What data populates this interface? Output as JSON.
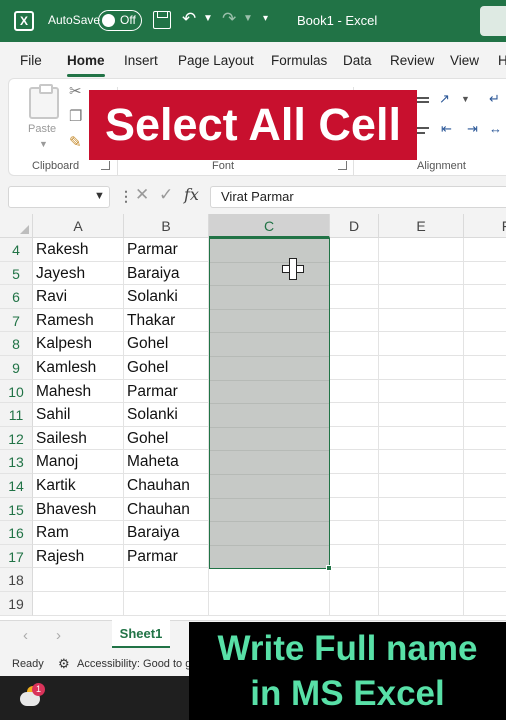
{
  "titlebar": {
    "autosave_label": "AutoSave",
    "autosave_state": "Off",
    "book_title": "Book1  -  Excel"
  },
  "menu": {
    "tabs": [
      "File",
      "Home",
      "Insert",
      "Page Layout",
      "Formulas",
      "Data",
      "Review",
      "View",
      "H"
    ],
    "active": "Home"
  },
  "ribbon": {
    "paste_label": "Paste",
    "groups": [
      "Clipboard",
      "Font",
      "Alignment"
    ]
  },
  "formula_bar": {
    "fx_label": "fx",
    "value": "Virat Parmar"
  },
  "grid": {
    "columns": [
      "A",
      "B",
      "C",
      "D",
      "E",
      "F"
    ],
    "selected_column": "C",
    "rows": [
      {
        "num": "4",
        "a": "Rakesh",
        "b": "Parmar"
      },
      {
        "num": "5",
        "a": "Jayesh",
        "b": "Baraiya"
      },
      {
        "num": "6",
        "a": "Ravi",
        "b": "Solanki"
      },
      {
        "num": "7",
        "a": "Ramesh",
        "b": "Thakar"
      },
      {
        "num": "8",
        "a": "Kalpesh",
        "b": "Gohel"
      },
      {
        "num": "9",
        "a": "Kamlesh",
        "b": "Gohel"
      },
      {
        "num": "10",
        "a": "Mahesh",
        "b": "Parmar"
      },
      {
        "num": "11",
        "a": "Sahil",
        "b": "Solanki"
      },
      {
        "num": "12",
        "a": "Sailesh",
        "b": "Gohel"
      },
      {
        "num": "13",
        "a": "Manoj",
        "b": "Maheta"
      },
      {
        "num": "14",
        "a": "Kartik",
        "b": "Chauhan"
      },
      {
        "num": "15",
        "a": "Bhavesh",
        "b": "Chauhan"
      },
      {
        "num": "16",
        "a": "Ram",
        "b": "Baraiya"
      },
      {
        "num": "17",
        "a": "Rajesh",
        "b": "Parmar"
      },
      {
        "num": "18",
        "a": "",
        "b": ""
      },
      {
        "num": "19",
        "a": "",
        "b": ""
      }
    ]
  },
  "sheets": {
    "active": "Sheet1"
  },
  "status": {
    "ready": "Ready",
    "accessibility": "Accessibility: Good to go"
  },
  "taskbar": {
    "badge": "1"
  },
  "overlays": {
    "top_banner": "Select All Cell",
    "bottom_line1": "Write Full name",
    "bottom_line2": "in MS Excel"
  },
  "colors": {
    "excel_green": "#217346",
    "banner_red": "#c8102e",
    "caption_green": "#58e0a7"
  }
}
